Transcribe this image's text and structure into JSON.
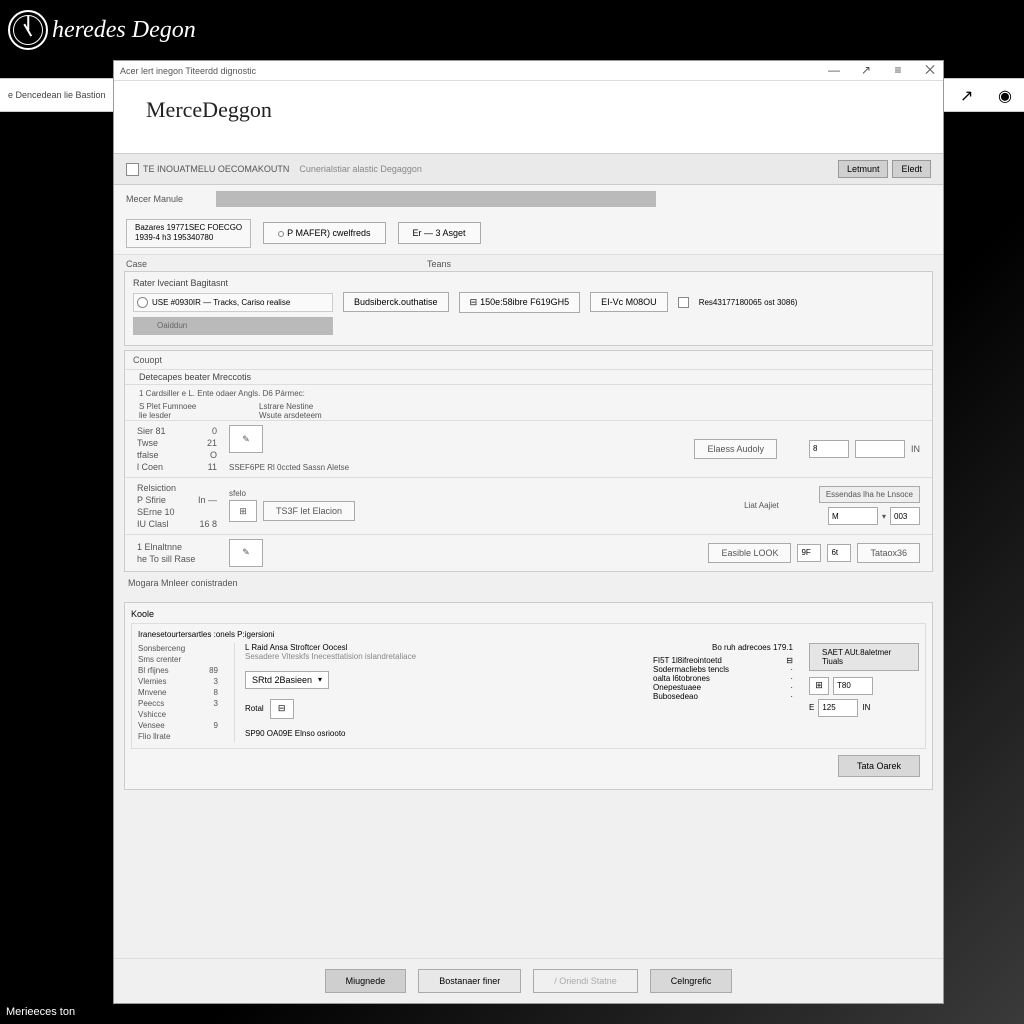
{
  "banner": {
    "title": "heredes Degon"
  },
  "subbanner": {
    "label": "e Dencedean lie Bastion"
  },
  "corner": "Merieeces ton",
  "titlebar": {
    "text": "Acer lert inegon Titeerdd dignostic"
  },
  "header": {
    "title": "MerceDeggon"
  },
  "toolbar": {
    "checkbox_label": "TE INOUATMELU OECOMAKOUTN",
    "sublabel": "Cunerialstiar alastic Degaggon",
    "btn1": "Letmunt",
    "btn2": "Eledt"
  },
  "maculebar": {
    "label": "Mecer Manule"
  },
  "inforow": {
    "box_line1": "Bazares 19771SEC FOECGO",
    "box_line2": "1939-4 h3 195340780",
    "btn1": "P MAFER) cwelfreds",
    "btn2": "Er — 3 Asget"
  },
  "sections": {
    "case": "Case",
    "teans": "Teans"
  },
  "case": {
    "title": "Rater lveciant Bagitasnt",
    "radio_label": "USE #0930IR — Tracks, Cariso realise",
    "sublabel": "Oaiddun",
    "btn1": "Budsiberck.outhatise",
    "btn2": "150e:58ibre F619GH5",
    "btn3": "EI-Vc M08OU",
    "chk_label": "Res43177180065 ost 3086)"
  },
  "group": {
    "legend": "Couopt",
    "sub": "Detecapes beater Mreccotis",
    "item1": "1   Cardsiller e   L. Ente odaer Angls. D6 Pármec:",
    "col1a": "S Plet Fumnoee",
    "col1b": "lie lesder",
    "col2a": "Lstrare Nestine",
    "col2b": "Wsute arsdeteem",
    "row1": {
      "l1": "Sier 81",
      "l1v": "0",
      "l2": "Twse",
      "l2v": "21",
      "l3": "tfalse",
      "l3v": "O",
      "l4": "l Coen",
      "l4v": "11",
      "mid": "SSEF6PE Rl 0ccted Sassn Aletse",
      "btn": "Elaess Audoly",
      "in1": "8",
      "in2": "",
      "unit": "IN"
    },
    "row2": {
      "l1": "Relsiction",
      "l1v": "",
      "l2": "P Sfirie",
      "l2v": "In —",
      "l3": "SErne 10",
      "l3v": "",
      "l4": "IU Clasl",
      "l4v": "16 8",
      "sublabel": "sfelo",
      "btn": "TS3F let Elacion",
      "rlabel": "Liat Aajiet",
      "box_label": "Essendas lha he Lnsoce",
      "in1": "M",
      "in3": "003"
    },
    "row3": {
      "l1": "1   Elnaltnne",
      "l2": "he To sill Rase",
      "btn": "Easible LOOK",
      "in1": "9F",
      "in2": "6t",
      "btn2": "Tataox36"
    }
  },
  "mogara": {
    "label": "Mogara Mnleer conistraden"
  },
  "koole": {
    "legend": "Koole",
    "sub": "Iranesetourtersartles :onels P:igersioni",
    "kv": {
      "k1": "Sonsberceng",
      "v1": "",
      "k2": "Sms crenter",
      "v2": "",
      "k3": "Bl rfijnes",
      "v3": "89",
      "k4": "Vlemies",
      "v4": "3",
      "k5": "Mnvene",
      "v5": "8",
      "k6": "Peeccs",
      "v6": "3",
      "k7": "Vshicce",
      "v7": "",
      "k8": "Vensee",
      "v8": "9",
      "k9": "Flio llrate",
      "v9": ""
    },
    "mid_line1": "L Raid Ansa Stroftcer Oocesl",
    "mid_line2": "Sesadere Viteskfs Inecesttatision islandretaliace",
    "dropdown": "SRtd 2Basieen",
    "rotal": "Rotal",
    "mid_bottom": "SP90 OA09E Elnso osriooto",
    "right_line1": "Bo ruh adrecoes",
    "right_v1": "179.1",
    "rk1": "FI5T 1l8ifreointoetd",
    "rk2": "Sodermacliebs tencls",
    "rk3": "oalta l6tobrones",
    "rk4": "Onepestuaee",
    "rk5": "Bubosedeao",
    "rbtn": "SAET AUt.8aletmer Tiuals",
    "rin1": "T80",
    "rin2": "125",
    "runit": "IN",
    "action": "Tata Oarek"
  },
  "footer": {
    "b1": "Miugnede",
    "b2": "Bostanaer finer",
    "b3": "/ Oriendi Statne",
    "b4": "Celngrefic"
  }
}
